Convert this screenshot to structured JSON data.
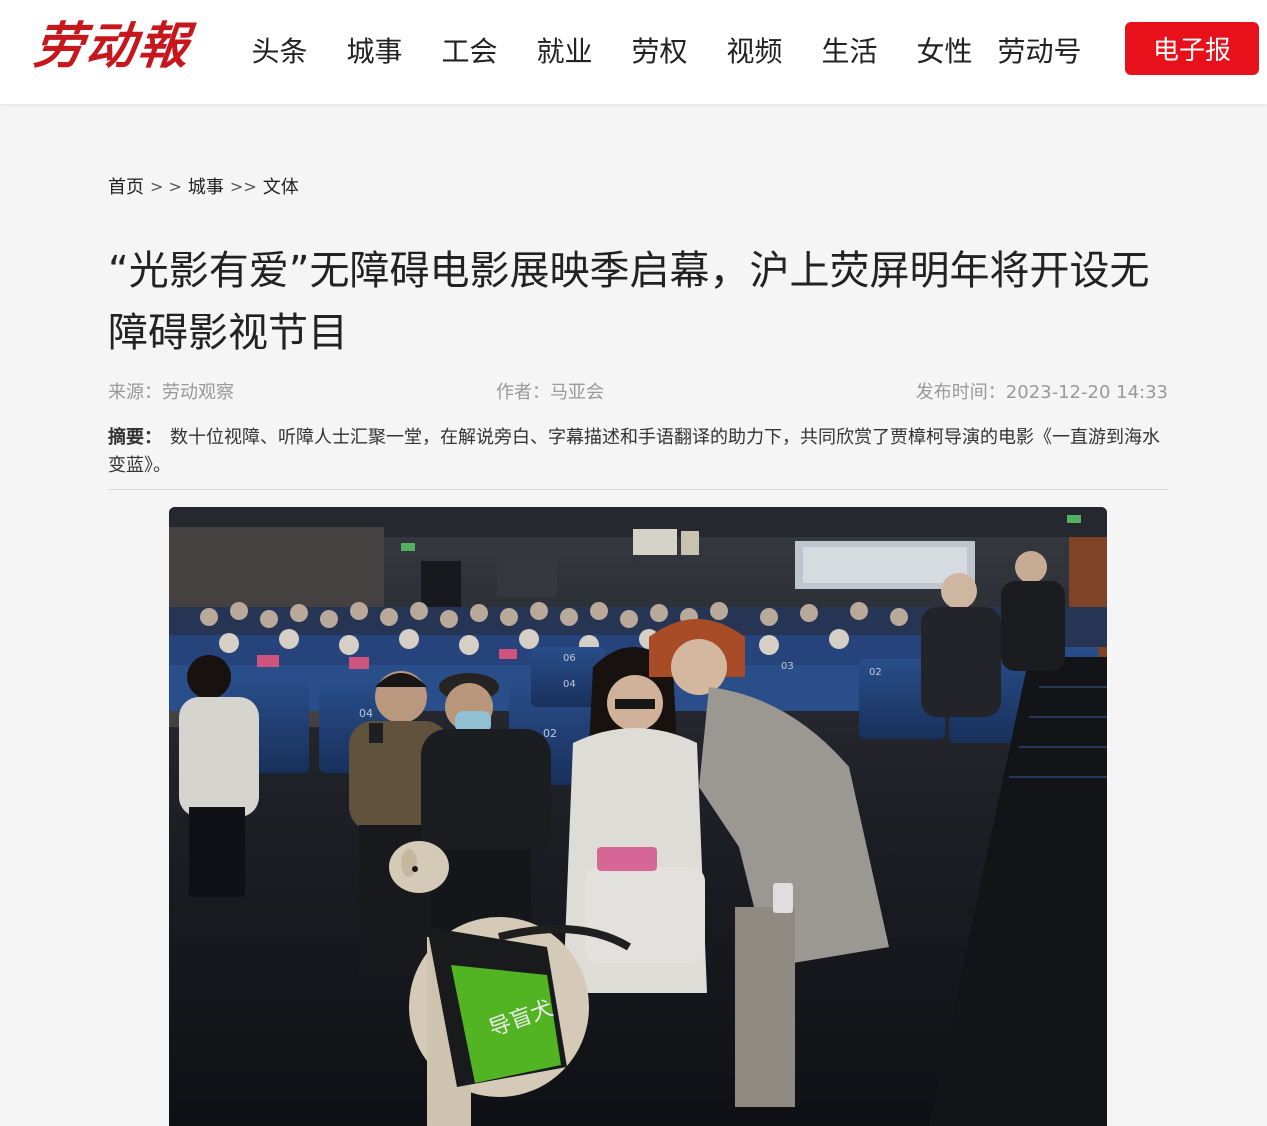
{
  "header": {
    "logo": "劳动報",
    "nav": [
      "头条",
      "城事",
      "工会",
      "就业",
      "劳权",
      "视频",
      "生活",
      "女性",
      "劳动号"
    ],
    "epaper_button": "电子报"
  },
  "breadcrumb": {
    "home": "首页",
    "sep1": "> >",
    "section": "城事",
    "sep2": ">>",
    "subsection": "文体"
  },
  "article": {
    "title": "“光影有爱”无障碍电影展映季启幕，沪上荧屏明年将开设无障碍影视节目",
    "source": "来源：劳动观察",
    "author": "作者：马亚会",
    "published": "发布时间：2023-12-20 14:33",
    "summary_label": "摘要：",
    "summary": "数十位视障、听障人士汇聚一堂，在解说旁白、字幕描述和手语翻译的助力下，共同欣赏了贾樟柯导演的电影《一直游到海水变蓝》。"
  },
  "photo": {
    "seat_labels": [
      "04",
      "02",
      "04",
      "06",
      "03",
      "02"
    ],
    "vest_text": "导盲犬"
  },
  "colors": {
    "brand_red": "#c8161d",
    "button_red": "#e8101a",
    "page_bg": "#f5f5f5"
  }
}
